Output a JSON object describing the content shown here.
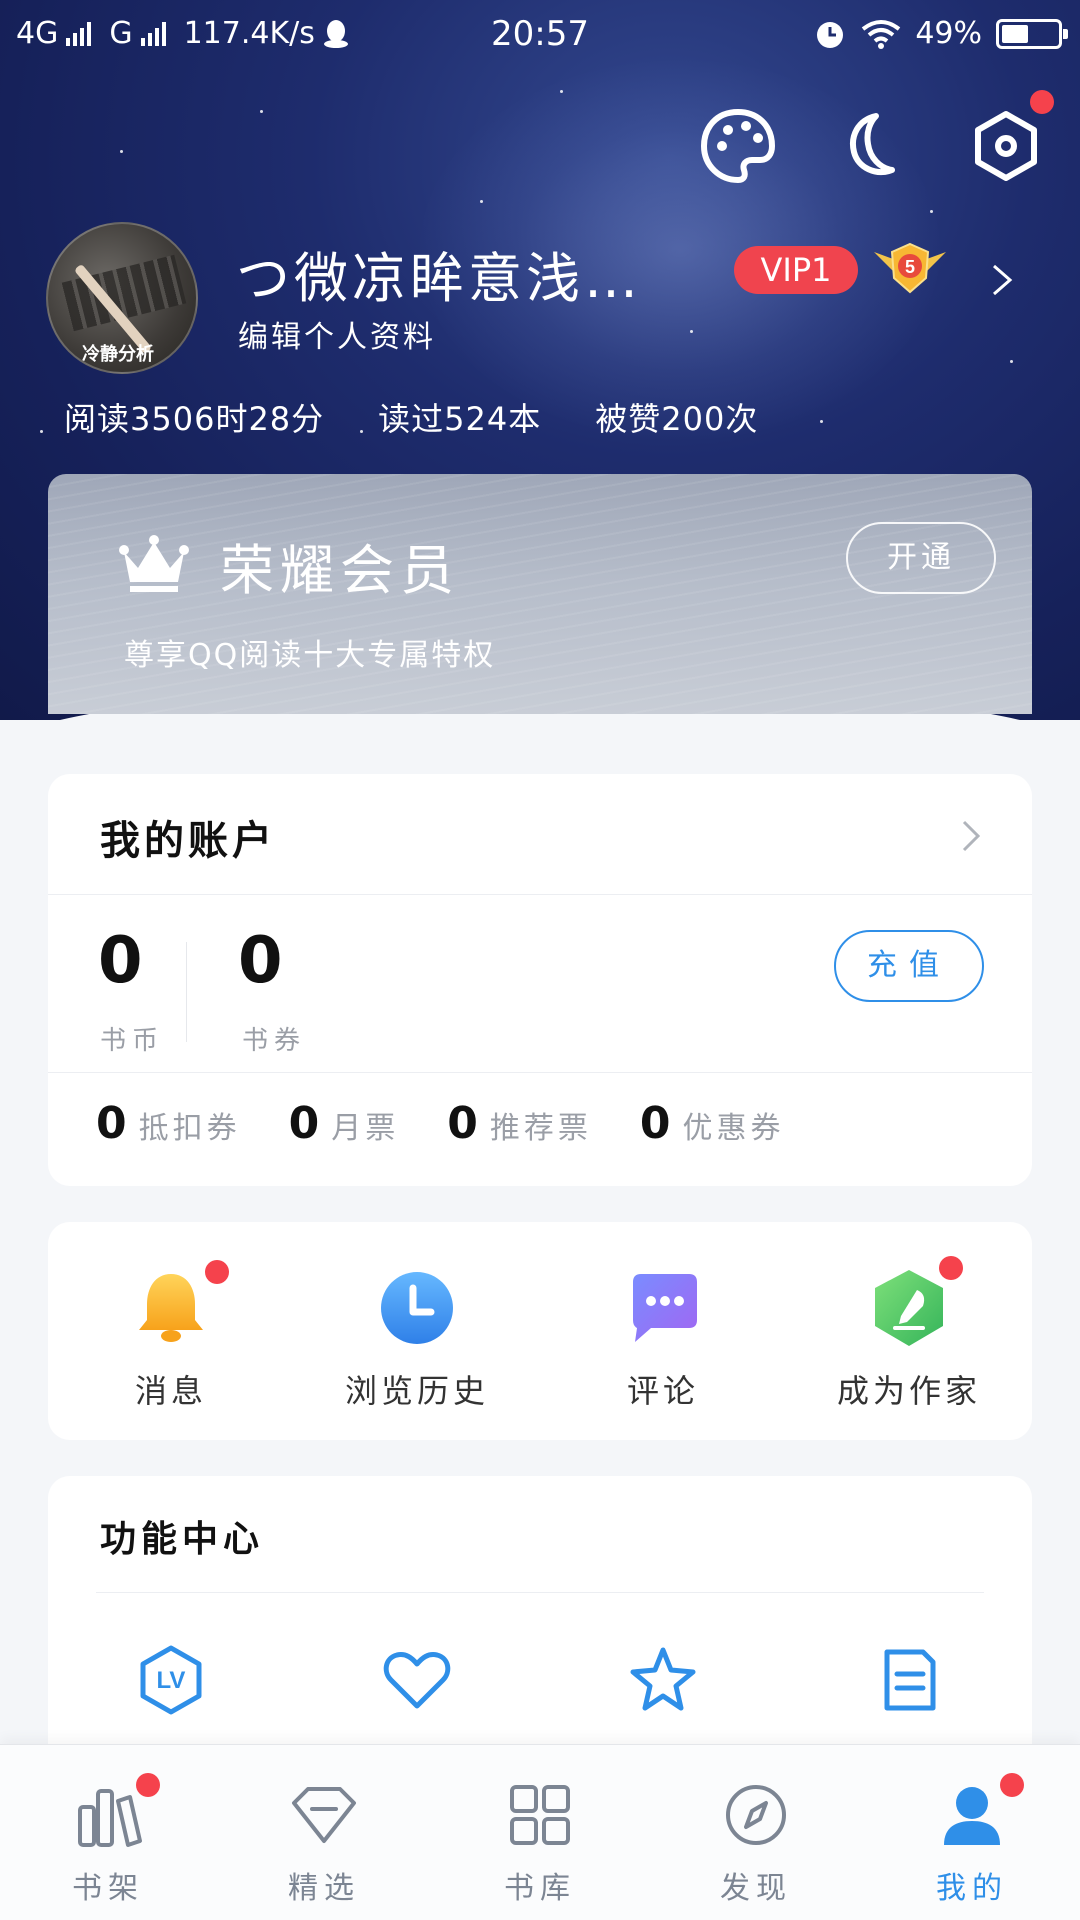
{
  "status_bar": {
    "network1": "4G",
    "network2": "G",
    "speed": "117.4K/s",
    "time": "20:57",
    "battery": "49%",
    "battery_level": 0.49
  },
  "profile": {
    "username": "つ微凉眸意浅…",
    "edit_label": "编辑个人资料",
    "avatar_watermark": "冷静分析",
    "vip_badge": "VIP1",
    "level": "5"
  },
  "stats": {
    "read_time": "阅读3506时28分",
    "books_read": "读过524本",
    "likes": "被赞200次"
  },
  "vip_card": {
    "title": "荣耀会员",
    "subtitle": "尊享QQ阅读十大专属特权",
    "button": "开通"
  },
  "account": {
    "title": "我的账户",
    "coins": {
      "value": "0",
      "label": "书币"
    },
    "vouchers": {
      "value": "0",
      "label": "书券"
    },
    "recharge": "充值",
    "tickets": [
      {
        "value": "0",
        "label": "抵扣券"
      },
      {
        "value": "0",
        "label": "月票"
      },
      {
        "value": "0",
        "label": "推荐票"
      },
      {
        "value": "0",
        "label": "优惠券"
      }
    ]
  },
  "quick_actions": [
    {
      "label": "消息",
      "icon": "bell-icon",
      "badge": true
    },
    {
      "label": "浏览历史",
      "icon": "clock-icon",
      "badge": false
    },
    {
      "label": "评论",
      "icon": "comment-icon",
      "badge": false
    },
    {
      "label": "成为作家",
      "icon": "pen-icon",
      "badge": true
    }
  ],
  "function_center": {
    "title": "功能中心",
    "items": [
      {
        "icon": "lv-icon"
      },
      {
        "icon": "heart-icon"
      },
      {
        "icon": "star-icon"
      },
      {
        "icon": "note-icon"
      }
    ]
  },
  "bottom_nav": [
    {
      "label": "书架",
      "icon": "bookshelf-icon",
      "badge": true,
      "active": false
    },
    {
      "label": "精选",
      "icon": "diamond-icon",
      "badge": false,
      "active": false
    },
    {
      "label": "书库",
      "icon": "grid-icon",
      "badge": false,
      "active": false
    },
    {
      "label": "发现",
      "icon": "compass-icon",
      "badge": false,
      "active": false
    },
    {
      "label": "我的",
      "icon": "person-icon",
      "badge": true,
      "active": true
    }
  ],
  "colors": {
    "accent": "#2f8fe8",
    "badge_red": "#f5424c",
    "vip_red": "#f0444e",
    "hero_dark": "#16215a"
  }
}
